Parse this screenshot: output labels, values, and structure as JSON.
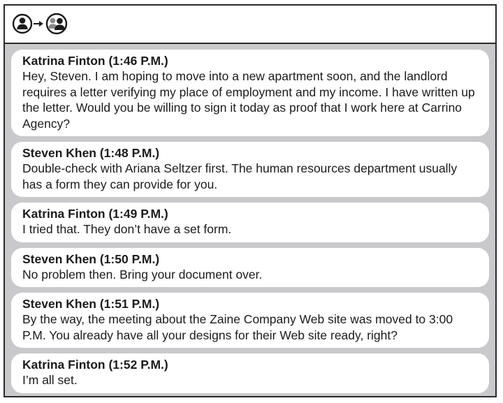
{
  "header": {
    "icons": [
      "single-user-icon",
      "arrow-right-icon",
      "group-users-icon"
    ]
  },
  "messages": [
    {
      "sender": "Katrina Finton",
      "time": "(1:46 P.M.)",
      "text": "Hey, Steven. I am hoping to move into a new apartment soon, and the landlord requires a letter verifying my place of employment and my income. I have written up the letter. Would you be willing to sign it today as proof that I work here at Carrino Agency?"
    },
    {
      "sender": "Steven Khen",
      "time": "(1:48 P.M.)",
      "text": "Double-check with Ariana Seltzer first. The human resources department usually has a form they can provide for you."
    },
    {
      "sender": "Katrina Finton",
      "time": "(1:49 P.M.)",
      "text": "I tried that. They don’t have a set form."
    },
    {
      "sender": "Steven Khen",
      "time": "(1:50 P.M.)",
      "text": "No problem then. Bring your document over."
    },
    {
      "sender": "Steven Khen",
      "time": "(1:51 P.M.)",
      "text": "By the way, the meeting about the Zaine Company Web site was moved to 3:00 P.M. You already have all your designs for their Web site ready, right?"
    },
    {
      "sender": "Katrina Finton",
      "time": "(1:52 P.M.)",
      "text": "I’m all set."
    }
  ]
}
